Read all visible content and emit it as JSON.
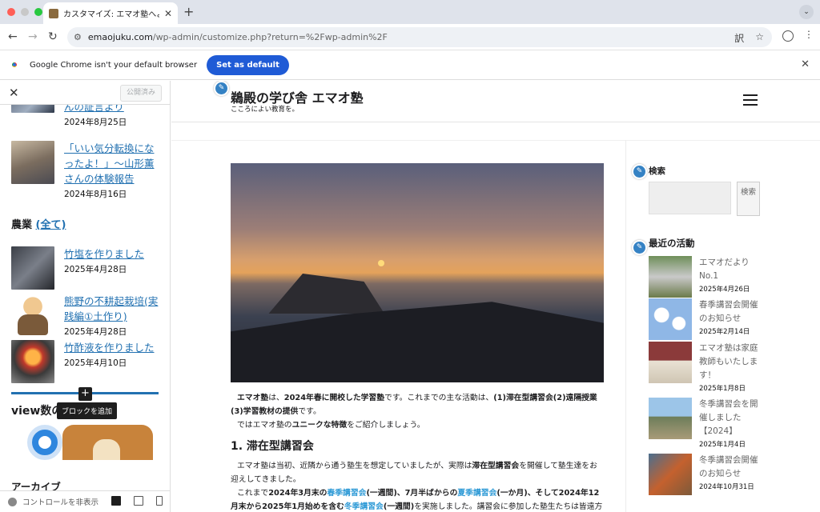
{
  "browser": {
    "tab_title": "カスタマイズ: エマオ塾へようこ",
    "url_host": "emaojuku.com",
    "url_path": "/wp-admin/customize.php?return=%2Fwp-admin%2F",
    "infobar_text": "Google Chrome isn't your default browser",
    "set_default_label": "Set as default"
  },
  "customizer": {
    "publish_label": "公開済み",
    "tooltip": "ブロックを追加",
    "view_count_heading": "view数の",
    "archive_heading": "アーカイブ",
    "hide_controls": "コントロールを非表示",
    "category_heading": "農業",
    "category_link": "(全て)",
    "posts_top": [
      {
        "title": "て！」〜稲本能子さんの証言より",
        "date": "2024年8月25日"
      },
      {
        "title": "「いい気分転換になったよ！」〜山形薫さんの体験報告",
        "date": "2024年8月16日"
      }
    ],
    "posts_agri": [
      {
        "title": "竹塩を作りました",
        "date": "2025年4月28日"
      },
      {
        "title": "熊野の不耕起栽培(実践編①土作り)",
        "date": "2025年4月28日"
      },
      {
        "title": "竹酢液を作りました",
        "date": "2025年4月10日"
      }
    ]
  },
  "site": {
    "title": "鵜殿の学び舎 エマオ塾",
    "tagline": "こころによい教育を。",
    "article": {
      "p1_a": "エマオ塾",
      "p1_b": "は、",
      "p1_c": "2024年春に開校した学習塾",
      "p1_d": "です。これまでの主な活動は、",
      "p1_e": "(1)滞在型講習会(2)遠隔授業(3)学習教材の提供",
      "p1_f": "です。",
      "p2_a": "では",
      "p2_b": "エマオ塾の",
      "p2_c": "ユニークな特徴",
      "p2_d": "をご紹介しましょう。",
      "h2": "1. 滞在型講習会",
      "p3_a": "エマオ塾は当初、近隣から通う塾生を想定していましたが、実際は",
      "p3_b": "滞在型講習会",
      "p3_c": "を開催して塾生達をお迎えしてきました。",
      "p4_a": "これまで",
      "p4_b": "2024年3月末の",
      "p4_c": "春季講習会",
      "p4_d": "(一週間)、7月半ばからの",
      "p4_e": "夏季講習会",
      "p4_f": "(一か月)、そして",
      "p4_g": "2024年12月末から2025年1月始めを含む",
      "p4_h": "冬季講習会",
      "p4_i": "(一週間)",
      "p4_j": "を実施しました。講習会に参加した塾生たちは皆遠方か"
    },
    "search_title": "検索",
    "search_button": "検索",
    "recent_title": "最近の活動",
    "recent": [
      {
        "title": "エマオだよりNo.1",
        "date": "2025年4月26日"
      },
      {
        "title": "春季講習会開催のお知らせ",
        "date": "2025年2月14日"
      },
      {
        "title": "エマオ塾は家庭教師もいたします！",
        "date": "2025年1月8日"
      },
      {
        "title": "冬季講習会を開催しました【2024】",
        "date": "2025年1月4日"
      },
      {
        "title": "冬季講習会開催のお知らせ",
        "date": "2024年10月31日"
      }
    ]
  }
}
